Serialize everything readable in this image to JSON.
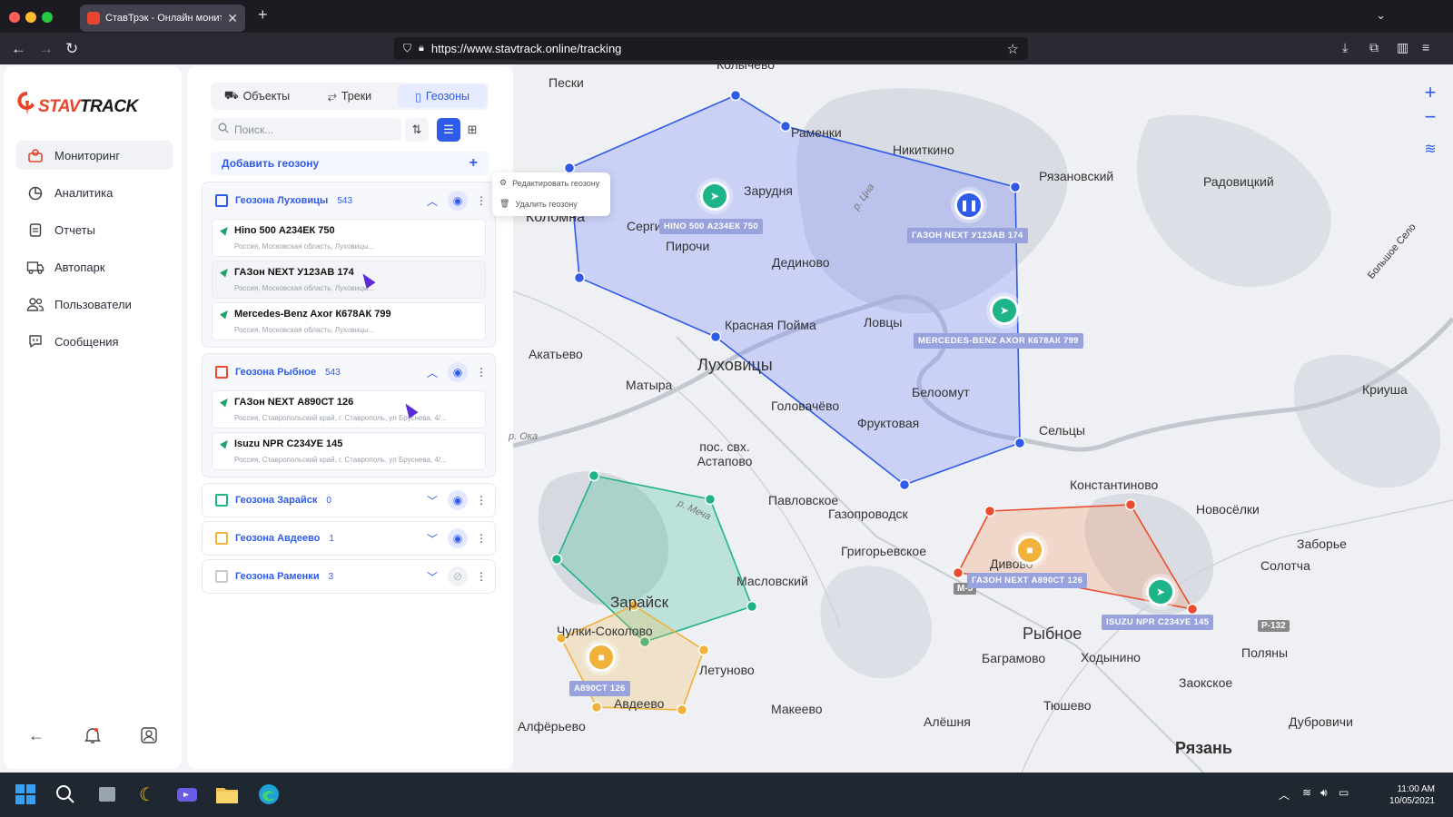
{
  "browser": {
    "tab_title": "СтавТрэк - Онлайн мониторинг",
    "url": "https://www.stavtrack.online/tracking"
  },
  "sidebar": {
    "logo_text": "STAVTRACK",
    "items": [
      {
        "label": "Мониторинг",
        "icon": "map-pin-icon",
        "active": true
      },
      {
        "label": "Аналитика",
        "icon": "pie-chart-icon"
      },
      {
        "label": "Отчеты",
        "icon": "clipboard-icon"
      },
      {
        "label": "Автопарк",
        "icon": "truck-icon"
      },
      {
        "label": "Пользователи",
        "icon": "users-icon"
      },
      {
        "label": "Сообщения",
        "icon": "chat-icon"
      }
    ]
  },
  "panel": {
    "tabs": [
      {
        "label": "Объекты",
        "icon": "car-icon"
      },
      {
        "label": "Треки",
        "icon": "route-icon"
      },
      {
        "label": "Геозоны",
        "icon": "map-icon",
        "active": true
      }
    ],
    "search_placeholder": "Поиск...",
    "add_geozone": "Добавить геозону",
    "add_symbol": "+",
    "groups": [
      {
        "name": "Геозона Луховицы",
        "count": "543",
        "color": "#2f5bea",
        "expanded": true,
        "vehicles": [
          {
            "name": "Hino 500 А234ЕК 750",
            "address": "Россия, Московская область, Луховицы..."
          },
          {
            "name": "ГАЗон NEXT У123АВ 174",
            "address": "Россия, Московская область, Луховицы..."
          },
          {
            "name": "Mercedes-Benz Axor К678АК 799",
            "address": "Россия, Московская область, Луховицы..."
          }
        ]
      },
      {
        "name": "Геозона Рыбное",
        "count": "543",
        "color": "#ea4c2f",
        "expanded": true,
        "vehicles": [
          {
            "name": "ГАЗон NEXT А890СТ 126",
            "address": "Россия, Ставропольский край, г. Ставрополь, ул Бруснева, 4/..."
          },
          {
            "name": "Isuzu NPR С234УЕ 145",
            "address": "Россия, Ставропольский край, г. Ставрополь, ул Бруснева, 4/..."
          }
        ]
      },
      {
        "name": "Геозона Зарайск",
        "count": "0",
        "color": "#1fb38a"
      },
      {
        "name": "Геозона Авдеево",
        "count": "1",
        "color": "#f0b23a"
      },
      {
        "name": "Геозона Раменки",
        "count": "3",
        "color": "#9aa0aa"
      }
    ]
  },
  "context_menu": {
    "edit": "Редактировать геозону",
    "delete": "Удалить геозону"
  },
  "map": {
    "places": [
      "Колычево",
      "Пески",
      "Раменки",
      "Никиткино",
      "Рязановский",
      "Радовицкий",
      "Зарудня",
      "Коломна",
      "Сергиевское",
      "Пирочи",
      "Дединово",
      "Красная Пойма",
      "Ловцы",
      "Акатьево",
      "Луховицы",
      "Матыра",
      "Головачёво",
      "Белоомут",
      "Фруктовая",
      "Сельцы",
      "Криуша",
      "пос. свх. Астапово",
      "Павловское",
      "Газопроводск",
      "Константиново",
      "Новосёлки",
      "Заборье",
      "Солотча",
      "Григорьевское",
      "Дивово",
      "Масловский",
      "Зарайск",
      "Чулки-Соколово",
      "Рыбное",
      "Летуново",
      "Авдеево",
      "Баграмово",
      "Ходынино",
      "Поляны",
      "Заокское",
      "Тюшево",
      "Макеево",
      "Алфёрьево",
      "Алёшня",
      "Дубровичи",
      "Рязань",
      "Большое Село",
      "р. Ока",
      "р. Меча",
      "р. Цна"
    ],
    "road_badges": [
      "М-5",
      "Р-132"
    ],
    "vehicle_labels": [
      "HINO 500 А234ЕК 750",
      "ГАЗОН NEXT У123АВ 174",
      "MERCEDES-BENZ AXOR К678АК 799",
      "ГАЗОН NEXT А890СТ 126",
      "ISUZU NPR С234УЕ 145",
      "А890СТ 126"
    ],
    "zoom_in": "+",
    "zoom_out": "−"
  },
  "taskbar": {
    "time": "11:00 AM",
    "date": "10/05/2021"
  }
}
